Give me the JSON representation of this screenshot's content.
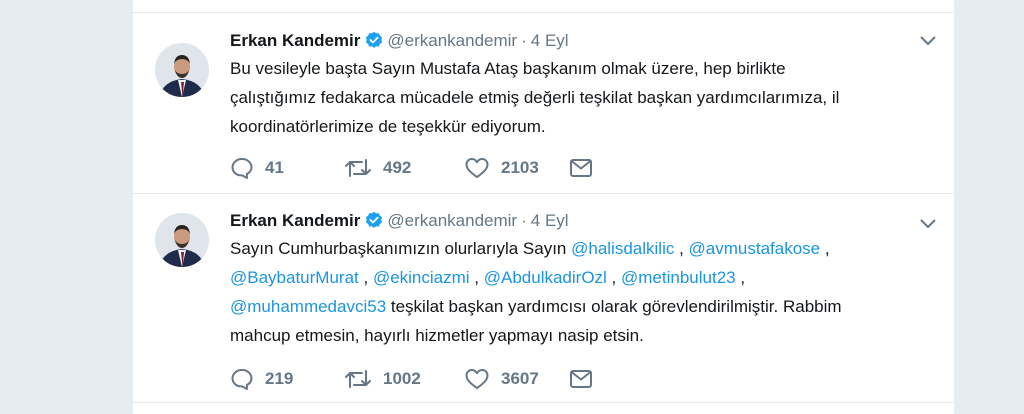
{
  "tweets": [
    {
      "name": "Erkan Kandemir",
      "handle": "@erkankandemir",
      "separator": "·",
      "time": "4 Eyl",
      "text_lines": [
        "Bu vesileyle başta Sayın Mustafa Ataş başkanım olmak üzere, hep birlikte",
        "çalıştığımız fedakarca mücadele etmiş değerli teşkilat başkan yardımcılarımıza, il",
        "koordinatörlerimize de teşekkür ediyorum."
      ],
      "replies": "41",
      "retweets": "492",
      "likes": "2103"
    },
    {
      "name": "Erkan Kandemir",
      "handle": "@erkankandemir",
      "separator": "·",
      "time": "4 Eyl",
      "line1_text": "Sayın Cumhurbaşkanımızın olurlarıyla Sayın ",
      "mention_halis": "@halisdalkilic",
      "sep_a": " , ",
      "mention_avmustafa": "@avmustafakose",
      "sep_b": " ,",
      "mention_baybatur": "@BaybaturMurat",
      "sep_c": " , ",
      "mention_ekinci": "@ekinciazmi",
      "sep_d": " , ",
      "mention_abdulkadir": "@AbdulkadirOzl",
      "sep_e": " , ",
      "mention_metin": "@metinbulut23",
      "sep_f": " ,",
      "mention_muhammed": "@muhammedavci53",
      "line3_text": " teşkilat başkan yardımcısı olarak görevlendirilmiştir. Rabbim",
      "line4_text": "mahcup etmesin, hayırlı hizmetler yapmayı nasip etsin.",
      "replies": "219",
      "retweets": "1002",
      "likes": "3607"
    }
  ],
  "colors": {
    "background": "#e6ecf0",
    "card": "#ffffff",
    "link": "#1b95e0",
    "muted": "#657786",
    "verified": "#1da1f2"
  },
  "icons": [
    "verified-badge-icon",
    "chevron-down-icon",
    "reply-icon",
    "retweet-icon",
    "like-icon",
    "direct-message-icon"
  ]
}
